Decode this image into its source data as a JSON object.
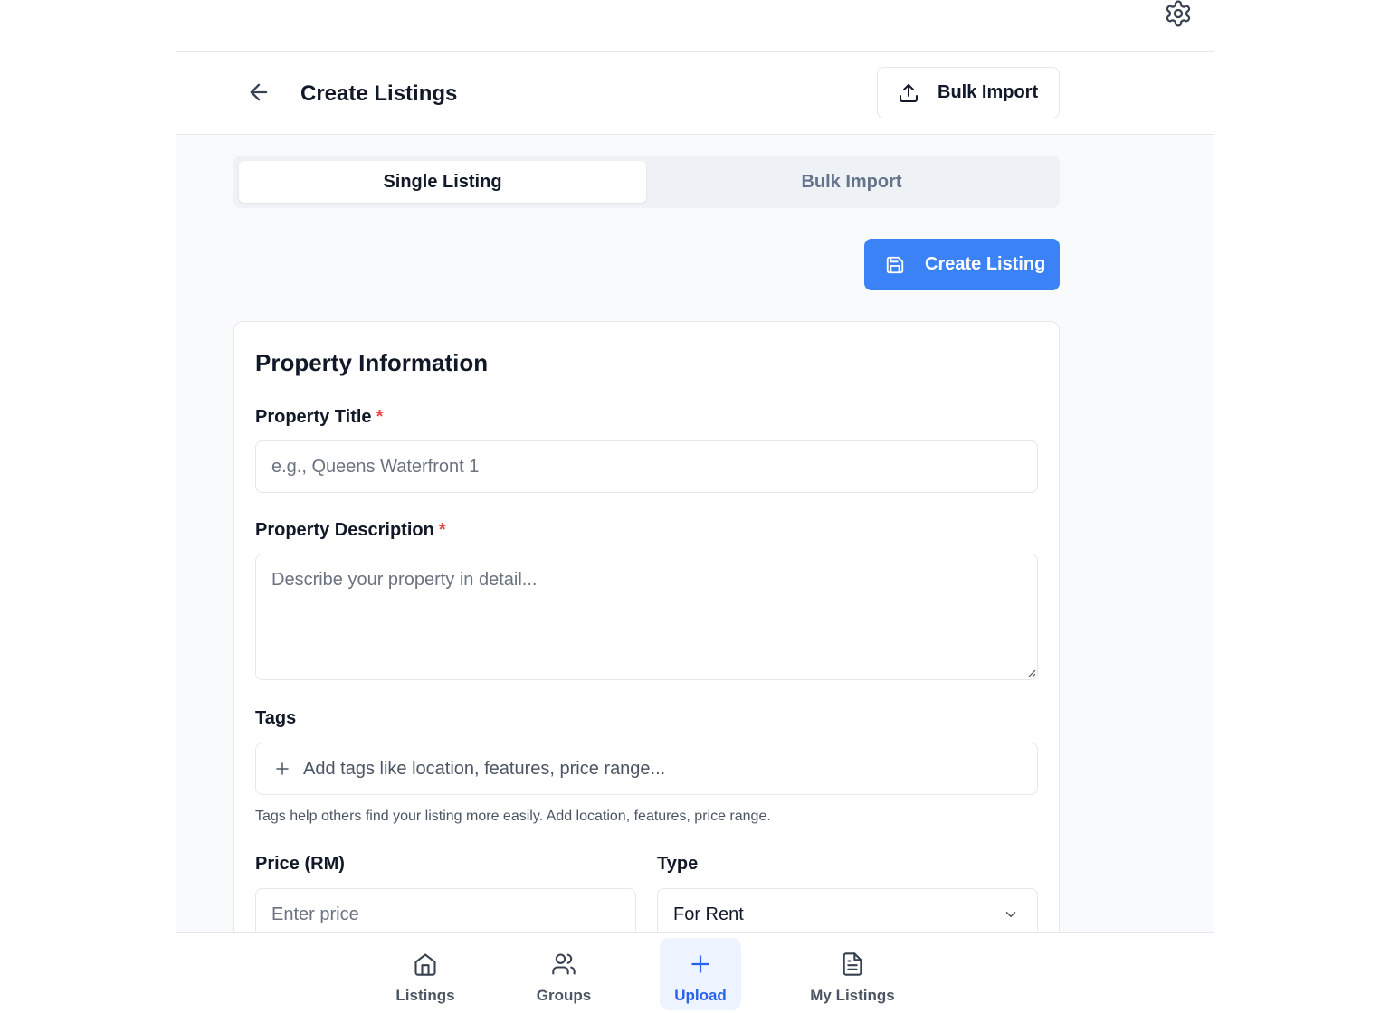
{
  "header": {
    "title": "Create Listings",
    "bulk_import_label": "Bulk Import"
  },
  "tabs": [
    {
      "label": "Single Listing",
      "active": true
    },
    {
      "label": "Bulk Import",
      "active": false
    }
  ],
  "create_button_label": "Create Listing",
  "form": {
    "section_title": "Property Information",
    "title_label": "Property Title",
    "required_mark": "*",
    "title_placeholder": "e.g., Queens Waterfront 1",
    "description_label": "Property Description",
    "description_placeholder": "Describe your property in detail...",
    "tags_label": "Tags",
    "tags_placeholder": "Add tags like location, features, price range...",
    "tags_hint": "Tags help others find your listing more easily. Add location, features, price range.",
    "price_label": "Price (RM)",
    "price_placeholder": "Enter price",
    "type_label": "Type",
    "type_value": "For Rent"
  },
  "bottom_nav": [
    {
      "label": "Listings",
      "icon": "home-icon",
      "active": false
    },
    {
      "label": "Groups",
      "icon": "users-icon",
      "active": false
    },
    {
      "label": "Upload",
      "icon": "plus-icon",
      "active": true
    },
    {
      "label": "My Listings",
      "icon": "document-icon",
      "active": false
    }
  ],
  "colors": {
    "accent": "#3b82f6",
    "required": "#ef4444",
    "nav_active_bg": "#eef4ff"
  }
}
